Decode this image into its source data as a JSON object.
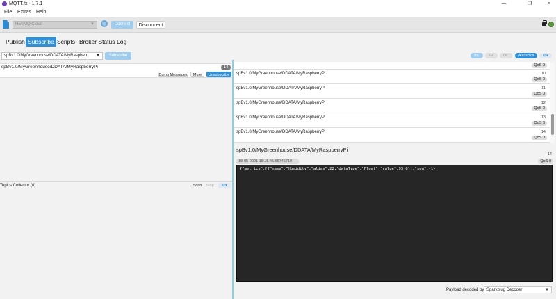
{
  "window": {
    "title": "MQTT.fx - 1.7.1",
    "minimize": "—",
    "maximize": "❐",
    "close": "✕"
  },
  "menu": [
    "File",
    "Extras",
    "Help"
  ],
  "connection": {
    "profile": "HiveMQ Cloud",
    "connect_label": "Connect",
    "disconnect_label": "Disconnect",
    "status_color": "#5c9a3c"
  },
  "tabs": [
    {
      "label": "Publish",
      "active": false
    },
    {
      "label": "Subscribe",
      "active": true
    },
    {
      "label": "Scripts",
      "active": false
    },
    {
      "label": "Broker Status",
      "active": false
    },
    {
      "label": "Log",
      "active": false
    }
  ],
  "subscribe": {
    "topic_input": "spBv1.0/MyGreenhouse/DDATA/MyRaspberr",
    "subscribe_label": "Subscribe",
    "subscription": {
      "topic": "spBv1.0/MyGreenhouse/DDATA/MyRaspberryPi",
      "count": "14",
      "dump_label": "Dump Messages",
      "mute_label": "Mute",
      "unsub_label": "Unsubscribe"
    },
    "collector": {
      "label": "Topics Collector (0)",
      "scan_label": "Scan",
      "stop_label": "Stop"
    }
  },
  "toolbar": {
    "pills": [
      "Bo.",
      "Gr.",
      "Oc.",
      "Autoscroll"
    ]
  },
  "messages": [
    {
      "topic": "",
      "num": "",
      "qos": "QoS 0"
    },
    {
      "topic": "spBv1.0/MyGreenhouse/DDATA/MyRaspberryPi",
      "num": "10",
      "qos": "QoS 0"
    },
    {
      "topic": "spBv1.0/MyGreenhouse/DDATA/MyRaspberryPi",
      "num": "11",
      "qos": "QoS 0"
    },
    {
      "topic": "spBv1.0/MyGreenhouse/DDATA/MyRaspberryPi",
      "num": "12",
      "qos": "QoS 0"
    },
    {
      "topic": "spBv1.0/MyGreenhouse/DDATA/MyRaspberryPi",
      "num": "13",
      "qos": "QoS 0"
    },
    {
      "topic": "spBv1.0/MyGreenhouse/DDATA/MyRaspberryPi",
      "num": "14",
      "qos": "QoS 0"
    }
  ],
  "detail": {
    "topic": "spBv1.0/MyGreenhouse/DDATA/MyRaspberryPi",
    "num": "14",
    "timestamp": "18-05-2021  18:15:45.65745710",
    "qos": "QoS 0",
    "payload": "{\"metrics\":[{\"name\":\"Humidity\",\"alias\":22,\"dataType\":\"Float\",\"value\":93.0}],\"seq\":-1}"
  },
  "decoder": {
    "label": "Payload decoded by",
    "value": "Sparkplug Decoder"
  }
}
